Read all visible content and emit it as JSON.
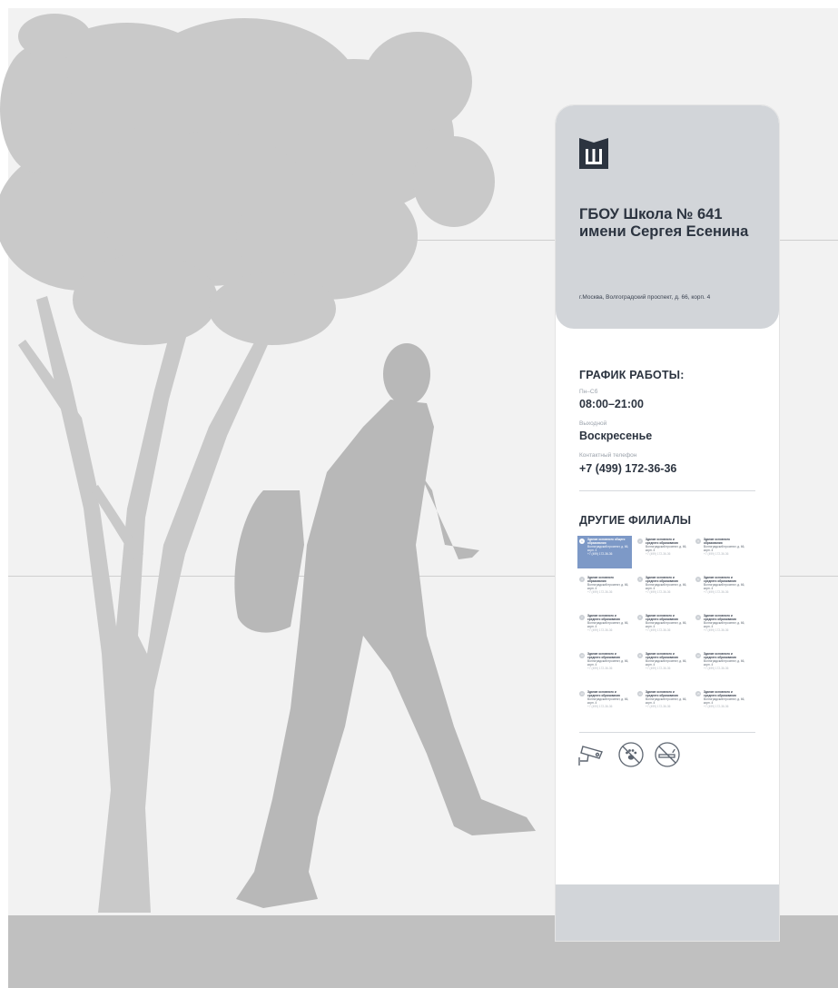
{
  "sign": {
    "title_line1": "ГБОУ Школа № 641",
    "title_line2": "имени Сергея Есенина",
    "address": "г.Москва, Волгоградский проспект, д. 66, корп. 4",
    "logo_icon": "school-logo-icon"
  },
  "schedule": {
    "heading": "ГРАФИК РАБОТЫ:",
    "weekdays_label": "Пн–Сб",
    "weekdays_hours": "08:00–21:00",
    "dayoff_label": "Выходной",
    "dayoff_value": "Воскресенье",
    "phone_label": "Контактный телефон",
    "phone": "+7 (499) 172-36-36"
  },
  "branches": {
    "heading": "ДРУГИЕ ФИЛИАЛЫ",
    "items": [
      {
        "title": "Здание основного общего образования",
        "address": "Волгоградский проспект, д. 66, корп. 4",
        "phone": "+7 (499) 172-36-36",
        "active": true
      },
      {
        "title": "Здание основного и среднего образования",
        "address": "Волгоградский проспект, д. 66, корп. 4",
        "phone": "+7 (499) 172-36-36",
        "active": false
      },
      {
        "title": "Здание основного образования",
        "address": "Волгоградский проспект, д. 66, корп. 4",
        "phone": "+7 (499) 172-36-36",
        "active": false
      },
      {
        "title": "Здание основного образования",
        "address": "Волгоградский проспект, д. 66, корп. 4",
        "phone": "+7 (499) 172-36-36",
        "active": false
      },
      {
        "title": "Здание основного и среднего образования",
        "address": "Волгоградский проспект, д. 66, корп. 4",
        "phone": "+7 (499) 172-36-36",
        "active": false
      },
      {
        "title": "Здание основного и среднего образования",
        "address": "Волгоградский проспект, д. 66, корп. 4",
        "phone": "+7 (499) 172-36-36",
        "active": false
      },
      {
        "title": "Здание основного и среднего образования",
        "address": "Волгоградский проспект, д. 66, корп. 4",
        "phone": "+7 (499) 172-36-36",
        "active": false
      },
      {
        "title": "Здание основного и среднего образования",
        "address": "Волгоградский проспект, д. 66, корп. 4",
        "phone": "+7 (499) 172-36-36",
        "active": false
      },
      {
        "title": "Здание основного и среднего образования",
        "address": "Волгоградский проспект, д. 66, корп. 4",
        "phone": "+7 (499) 172-36-36",
        "active": false
      },
      {
        "title": "Здание основного и среднего образования",
        "address": "Волгоградский проспект, д. 66, корп. 4",
        "phone": "+7 (499) 172-36-36",
        "active": false
      },
      {
        "title": "Здание основного и среднего образования",
        "address": "Волгоградский проспект, д. 66, корп. 4",
        "phone": "+7 (499) 172-36-36",
        "active": false
      },
      {
        "title": "Здание основного и среднего образования",
        "address": "Волгоградский проспект, д. 66, корп. 4",
        "phone": "+7 (499) 172-36-36",
        "active": false
      },
      {
        "title": "Здание основного и среднего образования",
        "address": "Волгоградский проспект, д. 66, корп. 4",
        "phone": "+7 (499) 172-36-36",
        "active": false
      },
      {
        "title": "Здание основного и среднего образования",
        "address": "Волгоградский проспект, д. 66, корп. 4",
        "phone": "+7 (499) 172-36-36",
        "active": false
      },
      {
        "title": "Здание основного и среднего образования",
        "address": "Волгоградский проспект, д. 66, корп. 4",
        "phone": "+7 (499) 172-36-36",
        "active": false
      }
    ]
  },
  "rules_icons": [
    "video-surveillance-icon",
    "no-pets-icon",
    "no-smoking-icon"
  ],
  "colors": {
    "wall": "#f2f2f2",
    "ground": "#c0c0c0",
    "silhouette": "#bdbdbd",
    "sign_panel": "#d2d5d9",
    "sign_text": "#2c3440",
    "accent": "#7d99c7"
  }
}
